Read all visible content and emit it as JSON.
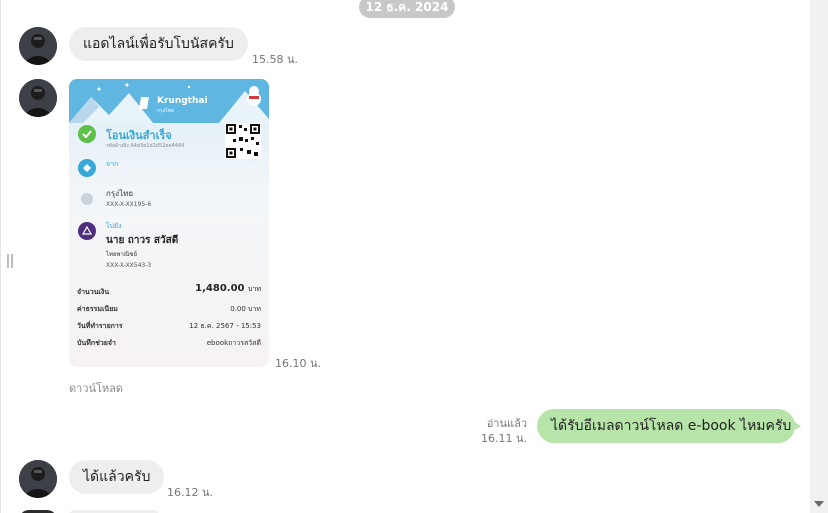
{
  "date_separator": "12 ธ.ค. 2024",
  "messages": [
    {
      "text": "แอดไลน์เพื่อรับโบนัสครับ",
      "time": "15.58 น."
    },
    {
      "time": "16.10 น.",
      "download_label": "ดาวน์โหลด",
      "slip": {
        "bank_name": "Krungthai",
        "bank_sub": "กรุงไทย",
        "status": "โอนเงินสำเร็จ",
        "ref": "รหัสอ้างอิง A4d3e1d2d52ee4484",
        "from_label": "จาก",
        "from_bank": "กรุงไทย",
        "from_account": "XXX-X-XX195-6",
        "to_label": "ไปยัง",
        "to_name": "นาย ถาวร สวัสดี",
        "to_bank": "ไทยพาณิชย์",
        "to_account": "XXX-X-XX543-3",
        "amount_label": "จำนวนเงิน",
        "amount_value": "1,480.00",
        "amount_unit": "บาท",
        "fee_label": "ค่าธรรมเนียม",
        "fee_value": "0.00 บาท",
        "date_label": "วันที่ทำรายการ",
        "date_value": "12 ธ.ค. 2567 - 15:53",
        "memo_label": "บันทึกช่วยจำ",
        "memo_value": "ebookถาวรสวัสดี"
      }
    },
    {
      "text": "ได้รับอีเมลดาวน์โหลด e-book ไหมครับ",
      "read_status": "อ่านแล้ว",
      "time": "16.11 น."
    },
    {
      "text": "ได้แล้วครับ",
      "time": "16.12 น."
    }
  ],
  "colors": {
    "incoming_bubble": "#eeeeee",
    "outgoing_bubble": "#b7e4a8",
    "date_pill": "#c8c8c8",
    "slip_accent": "#38a8d8"
  }
}
